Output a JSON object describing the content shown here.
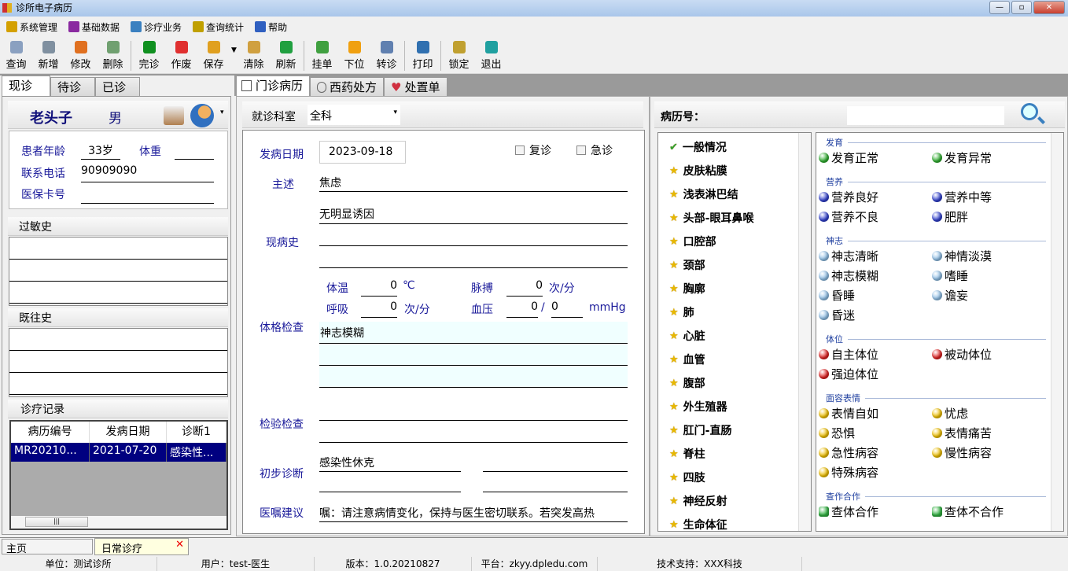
{
  "window": {
    "title": "诊所电子病历",
    "controls": [
      "—",
      "▫",
      "✕"
    ]
  },
  "menu": [
    {
      "label": "系统管理",
      "icon": "gear-icon",
      "color": "#d4a000"
    },
    {
      "label": "基础数据",
      "icon": "books-icon",
      "color": "#8a2aa0"
    },
    {
      "label": "诊疗业务",
      "icon": "users-icon",
      "color": "#3a80c0"
    },
    {
      "label": "查询统计",
      "icon": "chart-icon",
      "color": "#c0a000"
    },
    {
      "label": "帮助",
      "icon": "help-icon",
      "color": "#3060c0"
    }
  ],
  "toolbar": [
    {
      "label": "查询",
      "icon": "search-icon",
      "color": "#8aa0c0"
    },
    {
      "label": "新增",
      "icon": "new-doc-icon",
      "color": "#8090a0"
    },
    {
      "label": "修改",
      "icon": "pencil-icon",
      "color": "#e07020"
    },
    {
      "label": "删除",
      "icon": "trash-icon",
      "color": "#70a070"
    },
    {
      "sep": true
    },
    {
      "label": "完诊",
      "icon": "check-icon",
      "color": "#109020"
    },
    {
      "label": "作废",
      "icon": "cancel-icon",
      "color": "#e03030"
    },
    {
      "label": "保存",
      "icon": "save-icon",
      "color": "#e0a020",
      "dropdown": true
    },
    {
      "label": "清除",
      "icon": "broom-icon",
      "color": "#d0a040"
    },
    {
      "label": "刷新",
      "icon": "refresh-icon",
      "color": "#20a040"
    },
    {
      "sep": true
    },
    {
      "label": "挂单",
      "icon": "stack-icon",
      "color": "#40a040"
    },
    {
      "label": "下位",
      "icon": "arrow-right-icon",
      "color": "#f0a010"
    },
    {
      "label": "转诊",
      "icon": "transfer-icon",
      "color": "#6080b0"
    },
    {
      "sep": true
    },
    {
      "label": "打印",
      "icon": "print-icon",
      "color": "#3070b0"
    },
    {
      "sep": true
    },
    {
      "label": "锁定",
      "icon": "lock-icon",
      "color": "#c0a030"
    },
    {
      "label": "退出",
      "icon": "exit-icon",
      "color": "#20a0a0"
    }
  ],
  "left": {
    "tabs": [
      "现诊",
      "待诊",
      "已诊"
    ],
    "patient_name": "老头子",
    "gender": "男",
    "age_label": "患者年龄",
    "age": "33岁",
    "weight_label": "体重",
    "weight": "",
    "phone_label": "联系电话",
    "phone": "90909090",
    "card_label": "医保卡号",
    "card": "",
    "allergy_label": "过敏史",
    "history_label": "既往史",
    "records_label": "诊疗记录",
    "records": {
      "columns": [
        "病历编号",
        "发病日期",
        "诊断1"
      ],
      "rows": [
        [
          "MR20210...",
          "2021-07-20",
          "感染性..."
        ]
      ]
    }
  },
  "center": {
    "tabs": [
      "门诊病历",
      "西药处方",
      "处置单"
    ],
    "dept_label": "就诊科室",
    "dept": "全科",
    "onset_label": "发病日期",
    "onset": "2023-09-18",
    "revisit": "复诊",
    "emergency": "急诊",
    "complaint_label": "主述",
    "complaint": "焦虑",
    "present_label": "现病史",
    "present": "无明显诱因",
    "exam_label": "体格检查",
    "temp_label": "体温",
    "temp": "0",
    "temp_unit": "℃",
    "pulse_label": "脉搏",
    "pulse": "0",
    "pulse_unit": "次/分",
    "resp_label": "呼吸",
    "resp": "0",
    "resp_unit": "次/分",
    "bp_label": "血压",
    "bp_sys": "0",
    "bp_sep": "/",
    "bp_dia": "0",
    "bp_unit": "mmHg",
    "exam_text": "神志模糊",
    "lab_label": "检验检查",
    "diag_label": "初步诊断",
    "diag": "感染性休克",
    "advice_label": "医嘱建议",
    "advice": "嘱：请注意病情变化，保持与医生密切联系。若突发高热"
  },
  "right": {
    "record_no_label": "病历号：",
    "record_no": "",
    "tree": [
      "一般情况",
      "皮肤粘膜",
      "浅表淋巴结",
      "头部-眼耳鼻喉",
      "口腔部",
      "颈部",
      "胸廓",
      "肺",
      "心脏",
      "血管",
      "腹部",
      "外生殖器",
      "肛门-直肠",
      "脊柱",
      "四肢",
      "神经反射",
      "生命体征"
    ],
    "sections": [
      {
        "title": "发育",
        "color": "#30b030",
        "items": [
          "发育正常",
          "发育异常"
        ]
      },
      {
        "title": "营养",
        "color": "#3040d0",
        "items": [
          "营养良好",
          "营养中等",
          "营养不良",
          "肥胖"
        ]
      },
      {
        "title": "神志",
        "color": "#90c0e8",
        "items": [
          "神志清晰",
          "神情淡漠",
          "神志模糊",
          "嗜睡",
          "昏睡",
          "谵妄",
          "昏迷"
        ]
      },
      {
        "title": "体位",
        "color": "#e02020",
        "items": [
          "自主体位",
          "被动体位",
          "强迫体位"
        ]
      },
      {
        "title": "面容表情",
        "color": "#f0c000",
        "items": [
          "表情自如",
          "忧虑",
          "恐惧",
          "表情痛苦",
          "急性病容",
          "慢性病容",
          "特殊病容"
        ]
      },
      {
        "title": "查作合作",
        "color": "#30b040",
        "items": [
          "查体合作",
          "查体不合作"
        ]
      }
    ]
  },
  "bottom_tabs": [
    "主页",
    "日常诊疗"
  ],
  "status": [
    "单位：测试诊所",
    "用户：test-医生",
    "版本：1.0.20210827",
    "平台：zkyy.dpledu.com",
    "技术支持：XXX科技"
  ]
}
